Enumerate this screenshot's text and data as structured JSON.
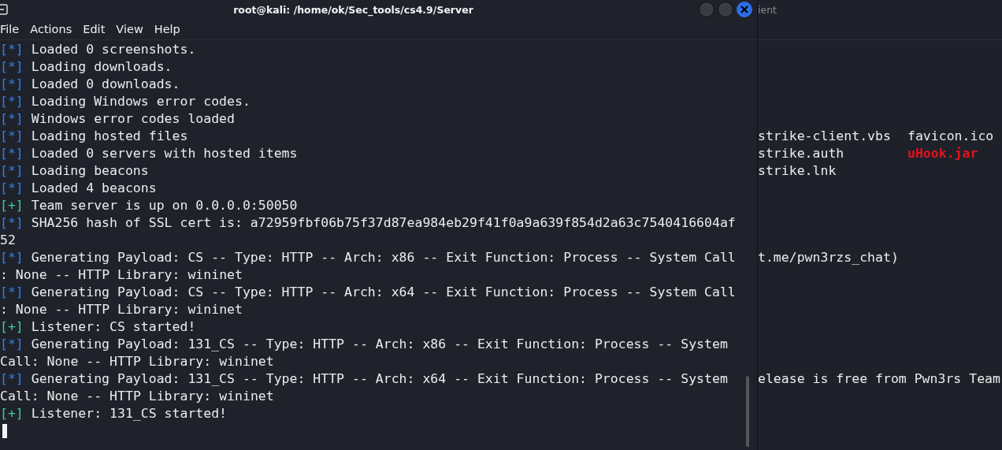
{
  "front_window": {
    "title": "root@kali: /home/ok/Sec_tools/cs4.9/Server",
    "menu": [
      "File",
      "Actions",
      "Edit",
      "View",
      "Help"
    ],
    "lines": [
      {
        "kind": "info",
        "text": "Loaded 0 screenshots."
      },
      {
        "kind": "info",
        "text": "Loading downloads."
      },
      {
        "kind": "info",
        "text": "Loaded 0 downloads."
      },
      {
        "kind": "info",
        "text": "Loading Windows error codes."
      },
      {
        "kind": "info",
        "text": "Windows error codes loaded"
      },
      {
        "kind": "info",
        "text": "Loading hosted files"
      },
      {
        "kind": "info",
        "text": "Loaded 0 servers with hosted items"
      },
      {
        "kind": "info",
        "text": "Loading beacons"
      },
      {
        "kind": "info",
        "text": "Loaded 4 beacons"
      },
      {
        "kind": "ok",
        "text": "Team server is up on 0.0.0.0:50050"
      },
      {
        "kind": "info",
        "text": "SHA256 hash of SSL cert is: a72959fbf06b75f37d87ea984eb29f41f0a9a639f854d2a63c7540416604af"
      },
      {
        "kind": "wrap",
        "text": "52"
      },
      {
        "kind": "info",
        "text": "Generating Payload: CS -- Type: HTTP -- Arch: x86 -- Exit Function: Process -- System Call"
      },
      {
        "kind": "wrap",
        "text": ": None -- HTTP Library: wininet"
      },
      {
        "kind": "info",
        "text": "Generating Payload: CS -- Type: HTTP -- Arch: x64 -- Exit Function: Process -- System Call"
      },
      {
        "kind": "wrap",
        "text": ": None -- HTTP Library: wininet"
      },
      {
        "kind": "ok",
        "text": "Listener: CS started!"
      },
      {
        "kind": "info",
        "text": "Generating Payload: 131_CS -- Type: HTTP -- Arch: x86 -- Exit Function: Process -- System"
      },
      {
        "kind": "wrap",
        "text": "Call: None -- HTTP Library: wininet"
      },
      {
        "kind": "info",
        "text": "Generating Payload: 131_CS -- Type: HTTP -- Arch: x64 -- Exit Function: Process -- System"
      },
      {
        "kind": "wrap",
        "text": "Call: None -- HTTP Library: wininet"
      },
      {
        "kind": "ok",
        "text": "Listener: 131_CS started!"
      }
    ],
    "markers": {
      "info": "[*]",
      "ok": "[+]"
    }
  },
  "back_window": {
    "title": "ient",
    "listing": [
      {
        "cells": [
          {
            "kind": "file",
            "text": "strike-client.vbs"
          },
          {
            "kind": "file",
            "text": "favicon.ico"
          }
        ]
      },
      {
        "cells": [
          {
            "kind": "file",
            "text": "strike.auth"
          },
          {
            "kind": "archive",
            "text": "uHook.jar"
          }
        ]
      },
      {
        "cells": [
          {
            "kind": "file",
            "text": "strike.lnk"
          }
        ]
      }
    ],
    "link_line": "t.me/pwn3rzs_chat)",
    "release_line": "elease is free from Pwn3rs Team"
  }
}
